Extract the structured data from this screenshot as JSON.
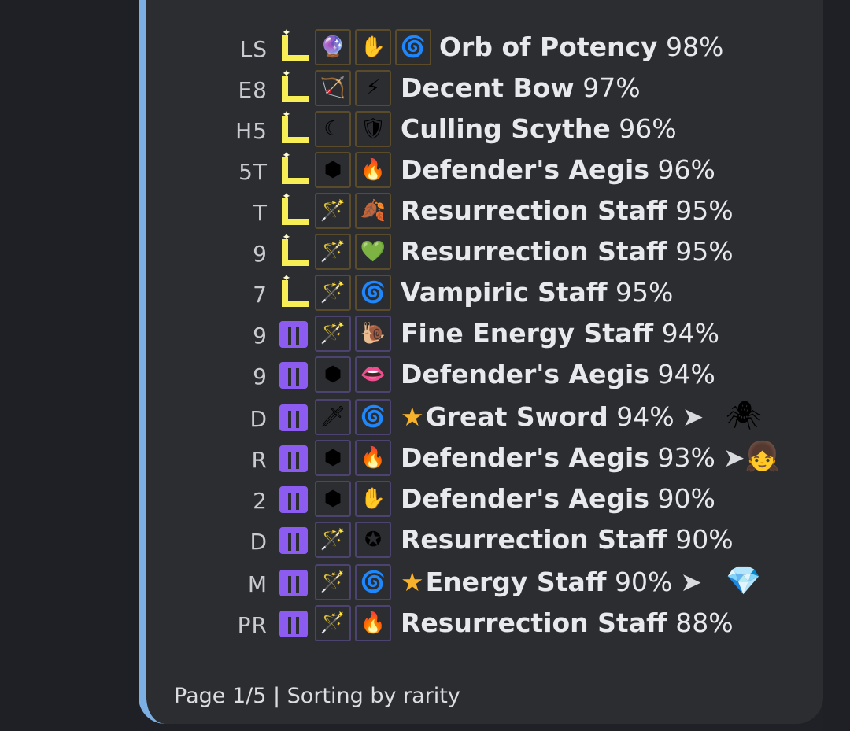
{
  "footer": "Page 1/5 | Sorting by rarity",
  "rows": [
    {
      "code": "LS",
      "rarity": "L",
      "slots": [
        "orb-icon",
        "fist-icon",
        "portal-icon"
      ],
      "name": "Orb of Potency",
      "pct": "98%",
      "star": false,
      "pet": ""
    },
    {
      "code": "E8",
      "rarity": "L",
      "slots": [
        "bow-icon",
        "lightning-icon"
      ],
      "name": "Decent Bow",
      "pct": "97%",
      "star": false,
      "pet": ""
    },
    {
      "code": "H5",
      "rarity": "L",
      "slots": [
        "scythe-icon",
        "shield-icon"
      ],
      "name": "Culling Scythe",
      "pct": "96%",
      "star": false,
      "pet": ""
    },
    {
      "code": "5T",
      "rarity": "L",
      "slots": [
        "aegis-icon",
        "fire-body-icon"
      ],
      "name": "Defender's Aegis",
      "pct": "96%",
      "star": false,
      "pet": ""
    },
    {
      "code": "T",
      "rarity": "L",
      "slots": [
        "staff-icon",
        "leaf-icon"
      ],
      "name": "Resurrection Staff",
      "pct": "95%",
      "star": false,
      "pet": ""
    },
    {
      "code": "9",
      "rarity": "L",
      "slots": [
        "staff-icon",
        "heart-icon"
      ],
      "name": "Resurrection Staff",
      "pct": "95%",
      "star": false,
      "pet": ""
    },
    {
      "code": "7",
      "rarity": "L",
      "slots": [
        "staff-icon",
        "portal-icon"
      ],
      "name": "Vampiric Staff",
      "pct": "95%",
      "star": false,
      "pet": ""
    },
    {
      "code": "9",
      "rarity": "M",
      "slots": [
        "staff-icon",
        "snail-icon"
      ],
      "name": "Fine Energy Staff",
      "pct": "94%",
      "star": false,
      "pet": ""
    },
    {
      "code": "9",
      "rarity": "M",
      "slots": [
        "aegis-icon",
        "fangs-icon"
      ],
      "name": "Defender's Aegis",
      "pct": "94%",
      "star": false,
      "pet": ""
    },
    {
      "code": "D",
      "rarity": "M",
      "slots": [
        "sword-icon",
        "portal-icon"
      ],
      "name": "Great Sword",
      "pct": "94%",
      "star": true,
      "pet": "spider-icon"
    },
    {
      "code": "R",
      "rarity": "M",
      "slots": [
        "aegis-icon",
        "fire-body-icon"
      ],
      "name": "Defender's Aegis",
      "pct": "93%",
      "star": false,
      "pet": "girl-icon"
    },
    {
      "code": "2",
      "rarity": "M",
      "slots": [
        "aegis-icon",
        "fist-icon"
      ],
      "name": "Defender's Aegis",
      "pct": "90%",
      "star": false,
      "pet": ""
    },
    {
      "code": "D",
      "rarity": "M",
      "slots": [
        "staff-icon",
        "rune-icon"
      ],
      "name": "Resurrection Staff",
      "pct": "90%",
      "star": false,
      "pet": ""
    },
    {
      "code": "M",
      "rarity": "M",
      "slots": [
        "staff-icon",
        "portal-icon"
      ],
      "name": "Energy Staff",
      "pct": "90%",
      "star": true,
      "pet": "gem-fish-icon"
    },
    {
      "code": "PR",
      "rarity": "M",
      "slots": [
        "staff-icon",
        "fire-body-icon"
      ],
      "name": "Resurrection Staff",
      "pct": "88%",
      "star": false,
      "pet": ""
    }
  ],
  "icon_glyphs": {
    "orb-icon": "🔮",
    "fist-icon": "✋",
    "portal-icon": "🌀",
    "bow-icon": "🏹",
    "lightning-icon": "⚡",
    "scythe-icon": "☾",
    "shield-icon": "🛡",
    "aegis-icon": "⬢",
    "fire-body-icon": "🔥",
    "staff-icon": "🪄",
    "leaf-icon": "🍂",
    "heart-icon": "💚",
    "snail-icon": "🐌",
    "fangs-icon": "👄",
    "sword-icon": "🗡",
    "rune-icon": "✪",
    "spider-icon": "🕷",
    "girl-icon": "👧",
    "gem-fish-icon": "💎"
  },
  "colors": {
    "accent_bar": "#7cb0e4",
    "legendary": "#f7ee55",
    "mythic": "#8c5cf0",
    "star": "#f7b12b"
  }
}
